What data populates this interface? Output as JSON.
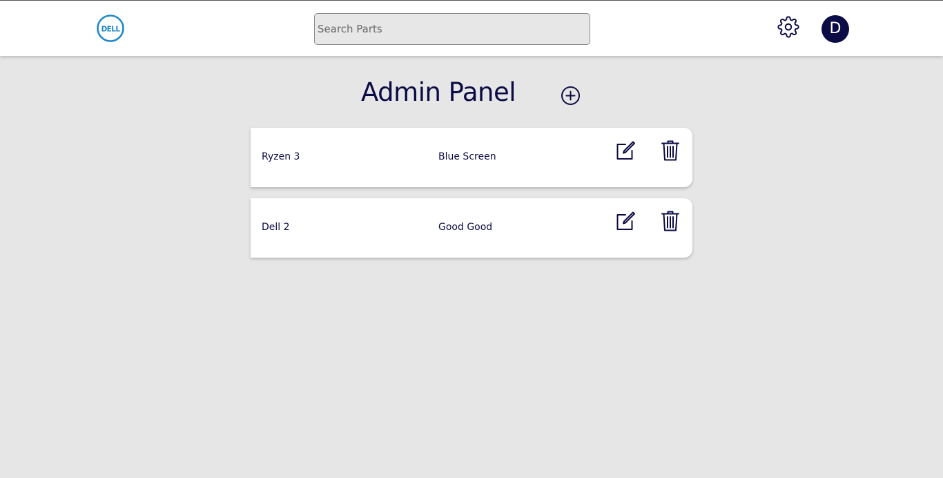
{
  "header": {
    "logo_text": "DELL",
    "search_placeholder": "Search Parts",
    "avatar_initial": "D",
    "icons": {
      "logo": "dell-logo",
      "settings": "gear-icon"
    }
  },
  "main": {
    "title": "Admin Panel",
    "add_icon": "plus-circle-icon",
    "items": [
      {
        "name": "Ryzen 3",
        "description": "Blue Screen"
      },
      {
        "name": "Dell 2",
        "description": "Good Good"
      }
    ],
    "row_icons": {
      "edit": "edit-icon",
      "delete": "trash-icon"
    }
  },
  "colors": {
    "brand_blue": "#1e88c9",
    "navy": "#0b0b45",
    "background": "#e6e6e6",
    "card": "#ffffff"
  }
}
